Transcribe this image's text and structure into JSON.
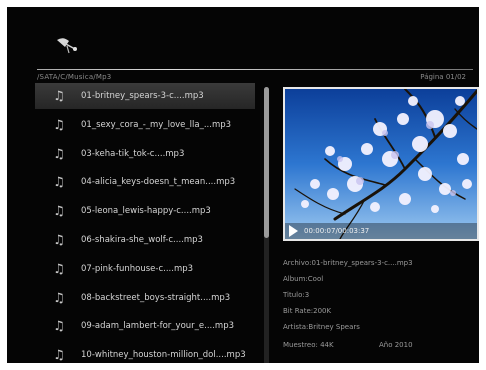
{
  "header": {
    "path": "/SATA/C/Musica/Mp3",
    "page": "Página 01/02"
  },
  "files": [
    "01-britney_spears-3-c....mp3",
    "01_sexy_cora_-_my_love_lla_...mp3",
    "03-keha-tik_tok-c....mp3",
    "04-alicia_keys-doesn_t_mean....mp3",
    "05-leona_lewis-happy-c....mp3",
    "06-shakira-she_wolf-c....mp3",
    "07-pink-funhouse-c....mp3",
    "08-backstreet_boys-straight....mp3",
    "09-adam_lambert-for_your_e....mp3",
    "10-whitney_houston-million_dol....mp3"
  ],
  "selected_index": 0,
  "list_scroll_fraction": 0.54,
  "player": {
    "time": "00:00:07/00:03:37"
  },
  "info": {
    "archivo": "Archivo:01-britney_spears-3-c....mp3",
    "album": "Album:Cool",
    "titulo": "Titulo:3",
    "bitrate": "Bit Rate:200K",
    "artista": "Artista:Britney Spears",
    "muestreo": "Muestreo: 44K",
    "anio": "Año 2010"
  },
  "icons": {
    "file": "music-note-icon",
    "play": "play-icon",
    "logo": "satellite-dish-icon"
  }
}
